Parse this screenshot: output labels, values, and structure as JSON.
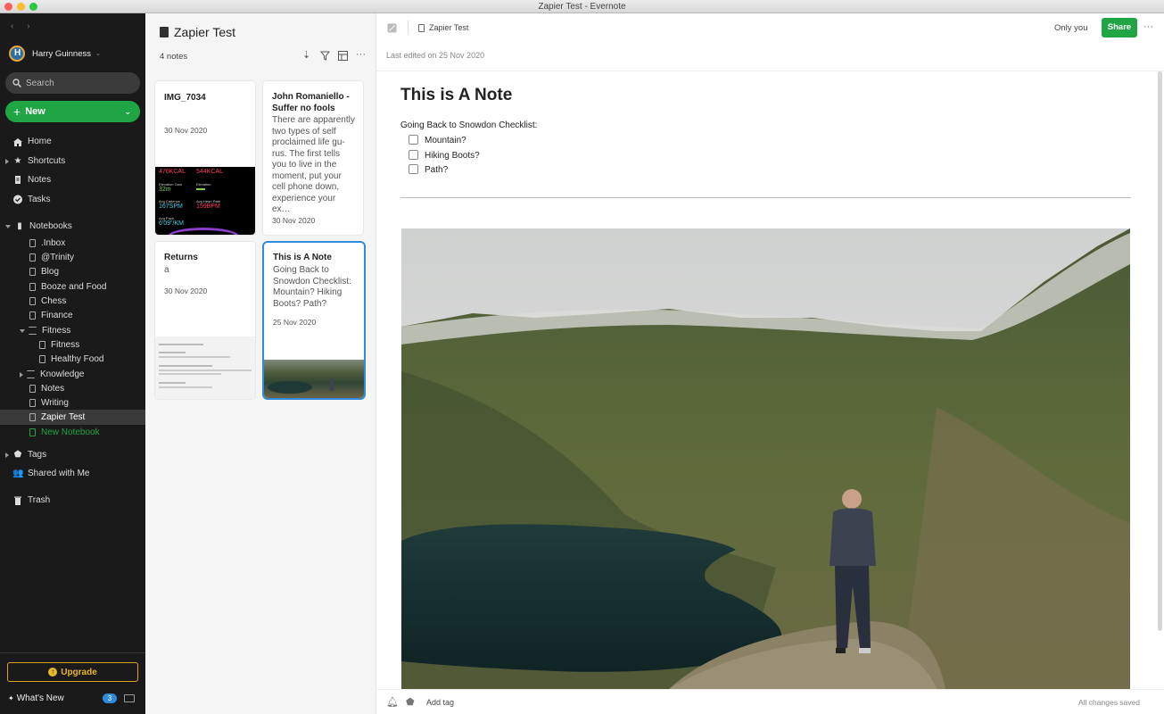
{
  "window": {
    "title": "Zapier Test - Evernote"
  },
  "sidebar": {
    "user": "Harry Guinness",
    "search_placeholder": "Search",
    "new_label": "New",
    "main_items": [
      {
        "label": "Home",
        "icon": "home-icon"
      },
      {
        "label": "Shortcuts",
        "icon": "star-icon"
      },
      {
        "label": "Notes",
        "icon": "note-icon"
      },
      {
        "label": "Tasks",
        "icon": "check-circle-icon"
      }
    ],
    "notebooks_label": "Notebooks",
    "notebooks": [
      ".Inbox",
      "@Trinity",
      "Blog",
      "Booze and Food",
      "Chess",
      "Finance",
      "Fitness",
      "Fitness",
      "Healthy Food",
      "Knowledge",
      "Notes",
      "Writing",
      "Zapier Test"
    ],
    "new_notebook": "New Notebook",
    "tags": "Tags",
    "shared": "Shared with Me",
    "trash": "Trash",
    "upgrade": "Upgrade",
    "whats_new": "What's New",
    "whats_new_count": "3"
  },
  "note_list": {
    "title": "Zapier Test",
    "count": "4 notes",
    "notes": [
      {
        "title": "IMG_7034",
        "snippet": "",
        "date": "30 Nov 2020"
      },
      {
        "title": "John Romaniello - Suffer no fools",
        "snippet": "There are apparent­ly two types of self proclaimed life gu­rus. The first tells you to live in the moment, put your cell phone down, experience your ex…",
        "date": "30 Nov 2020"
      },
      {
        "title": "Returns",
        "snippet": "a",
        "date": "30 Nov 2020"
      },
      {
        "title": "This is A Note",
        "snippet": "Going Back to Snowdon Checklist: Mountain? Hiking Boots? Path?",
        "date": "25 Nov 2020"
      }
    ],
    "watch": {
      "move": "476KCAL",
      "total": "544KCAL",
      "gain_label": "Elevation Gain",
      "gain": "32m",
      "elev_label": "Elevation",
      "elev": "",
      "cad_label": "Avg Cadence",
      "cad": "167SPM",
      "hr_label": "Avg Heart Rate",
      "hr": "159BPM",
      "pace_label": "Avg Pace",
      "pace": "6'09\"/KM"
    }
  },
  "editor": {
    "notebook": "Zapier Test",
    "sharing": "Only you",
    "share": "Share",
    "last_edited": "Last edited on 25 Nov 2020",
    "title": "This is A Note",
    "intro": "Going Back to Snowdon Checklist:",
    "checklist": [
      "Mountain?",
      "Hiking Boots?",
      "Path?"
    ],
    "add_tag": "Add tag",
    "status": "All changes saved"
  },
  "colors": {
    "accent": "#1fa544",
    "sidebar": "#1a1a1a",
    "selected_border": "#2f8cdc",
    "upgrade": "#e6b62c"
  }
}
